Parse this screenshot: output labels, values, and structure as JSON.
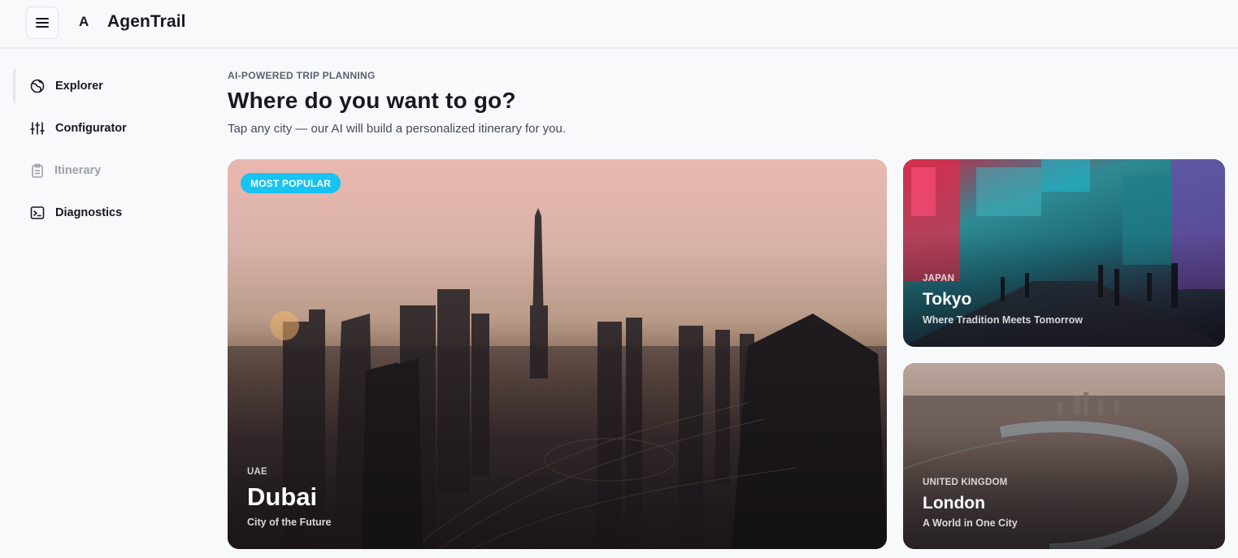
{
  "app": {
    "brand_mark": "A",
    "brand_name": "AgenTrail",
    "menu_icon": "hamburger-menu-icon"
  },
  "sidebar": {
    "items": [
      {
        "label": "Explorer",
        "icon": "globe-icon",
        "state": "active"
      },
      {
        "label": "Configurator",
        "icon": "sliders-icon",
        "state": "normal"
      },
      {
        "label": "Itinerary",
        "icon": "clipboard-icon",
        "state": "disabled"
      },
      {
        "label": "Diagnostics",
        "icon": "terminal-icon",
        "state": "normal"
      }
    ]
  },
  "main": {
    "eyebrow": "AI-POWERED TRIP PLANNING",
    "title": "Where do you want to go?",
    "subtitle": "Tap any city — our AI will build a personalized itinerary for you."
  },
  "destinations": [
    {
      "badge": "MOST POPULAR",
      "country": "UAE",
      "city": "Dubai",
      "tagline": "City of the Future"
    },
    {
      "country": "JAPAN",
      "city": "Tokyo",
      "tagline": "Where Tradition Meets Tomorrow"
    },
    {
      "country": "UNITED KINGDOM",
      "city": "London",
      "tagline": "A World in One City"
    }
  ],
  "colors": {
    "accent_badge": "#17c3f0",
    "background": "#f8f9fb",
    "text_primary": "#151921",
    "text_muted": "#9ba1ac"
  }
}
